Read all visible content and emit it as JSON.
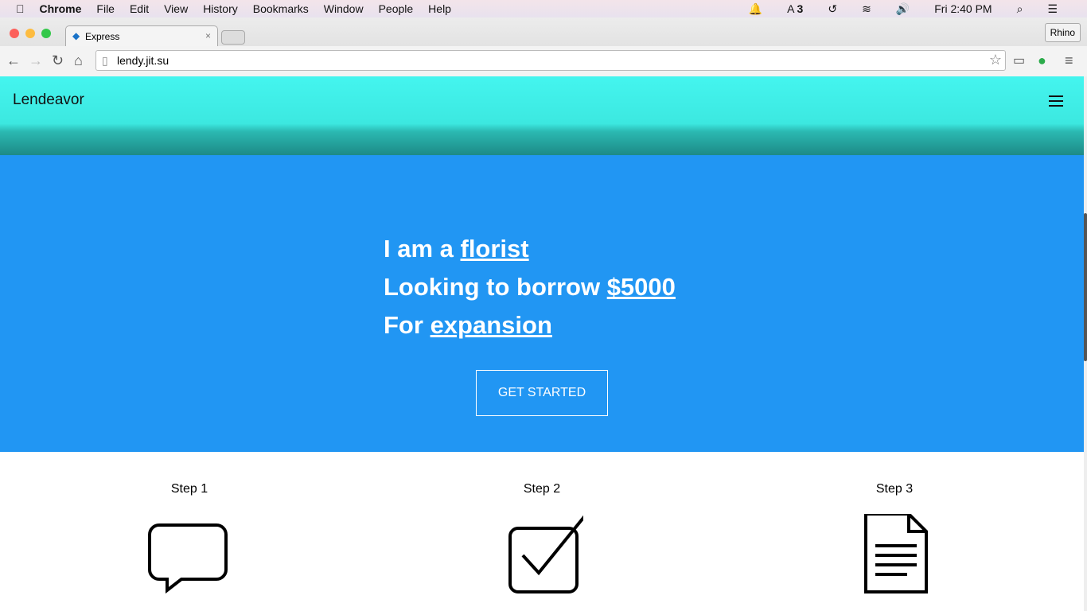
{
  "menubar": {
    "app": "Chrome",
    "items": [
      "File",
      "Edit",
      "View",
      "History",
      "Bookmarks",
      "Window",
      "People",
      "Help"
    ],
    "status": {
      "adobe_count": "3",
      "clock": "Fri 2:40 PM"
    }
  },
  "browser": {
    "tab_title": "Express",
    "url": "lendy.jit.su",
    "profile": "Rhino"
  },
  "site": {
    "brand": "Lendeavor",
    "hero": {
      "l1_pre": "I am a ",
      "l1_link": "florist",
      "l2_pre": "Looking to borrow ",
      "l2_link": "$5000",
      "l3_pre": "For ",
      "l3_link": "expansion",
      "cta": "GET STARTED"
    },
    "steps": [
      "Step 1",
      "Step 2",
      "Step 3"
    ]
  }
}
